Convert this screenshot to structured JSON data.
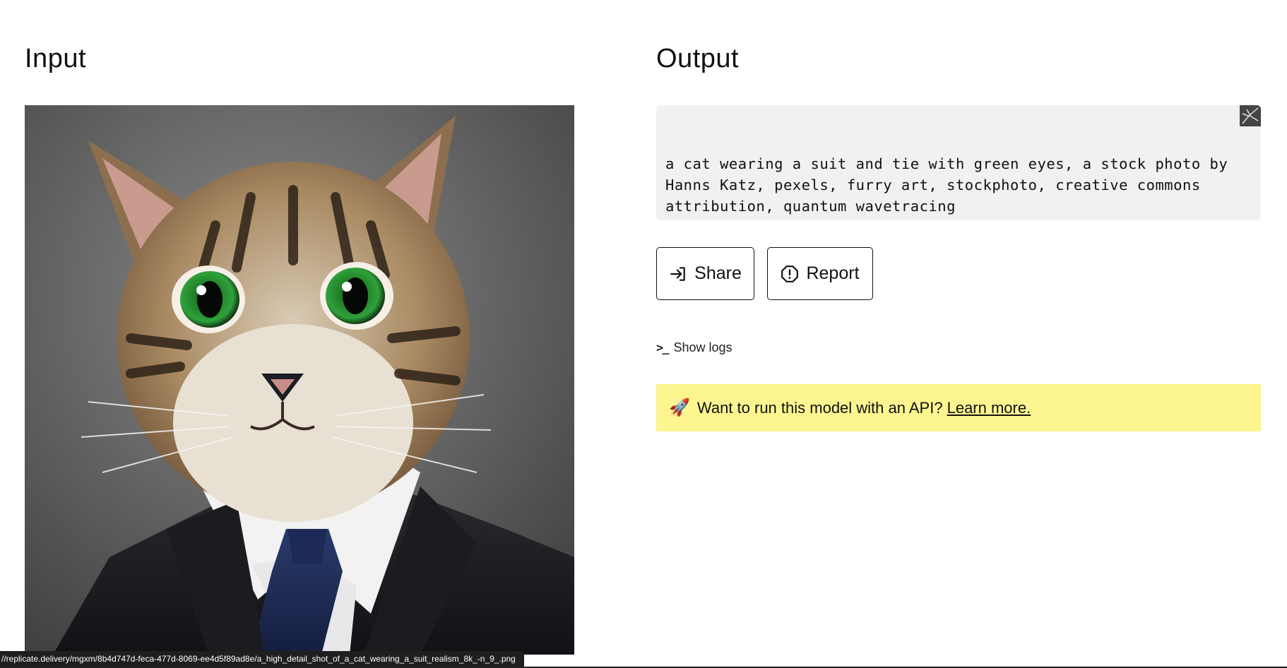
{
  "input": {
    "title": "Input",
    "image_alt": "a high detail shot of a cat wearing a suit"
  },
  "output": {
    "title": "Output",
    "caption": "a cat wearing a suit and tie with green eyes, a stock photo by Hanns Katz, pexels, furry art, stockphoto, creative commons attribution, quantum wavetracing"
  },
  "actions": {
    "share_label": "Share",
    "report_label": "Report",
    "show_logs_label": "Show logs",
    "show_logs_icon": ">_"
  },
  "api_banner": {
    "icon": "🚀",
    "text": "Want to run this model with an API?",
    "link_label": "Learn more."
  },
  "status_bar": {
    "url": "//replicate.delivery/mgxm/8b4d747d-feca-477d-8069-ee4d5f89ad8e/a_high_detail_shot_of_a_cat_wearing_a_suit_realism_8k_-n_9_.png"
  },
  "colors": {
    "banner_bg": "#fdf58f",
    "output_box_bg": "#f1f1f1",
    "button_border": "#111111"
  },
  "icons": {
    "share": "share-arrow-icon",
    "report": "report-alert-icon",
    "terminal": "terminal-prompt-icon",
    "rocket": "rocket-icon"
  }
}
